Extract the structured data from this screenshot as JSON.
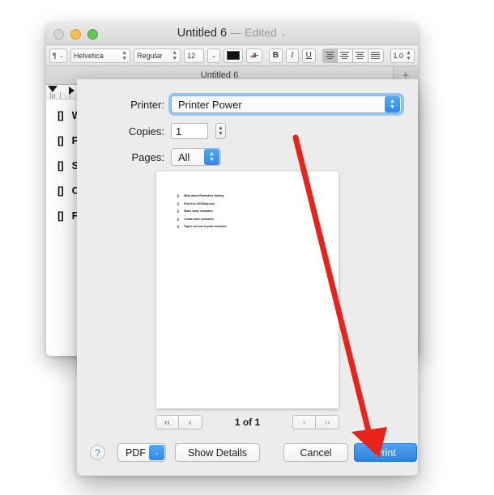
{
  "window": {
    "title": "Untitled 6",
    "separator": "—",
    "edited_label": "Edited",
    "edited_chevron": "⌄",
    "tab_label": "Untitled 6",
    "add_tab_glyph": "+",
    "ruler_zero": "0"
  },
  "format_bar": {
    "paragraph_glyph": "¶",
    "paragraph_chevron": "⌄",
    "font_family": "Helvetica",
    "font_style": "Regular",
    "font_size": "12",
    "size_chevron": "⌄",
    "text_color": "#111111",
    "strike_glyph": "a",
    "bold_glyph": "B",
    "italic_glyph": "I",
    "underline_glyph": "U",
    "line_spacing": "1.0",
    "stepper_up": "▲",
    "stepper_down": "▼"
  },
  "document": {
    "lines": [
      {
        "checkbox": "[]",
        "text": "Write about Reminders sharing"
      },
      {
        "checkbox": "[]",
        "text": "Print it to OSXDaily.com"
      },
      {
        "checkbox": "[]",
        "text": "Share some reminders"
      },
      {
        "checkbox": "[]",
        "text": "Create some reminders"
      },
      {
        "checkbox": "[]",
        "text": "Figure out how to print reminders"
      }
    ]
  },
  "print_sheet": {
    "printer_label": "Printer:",
    "printer_value": "Printer Power",
    "copies_label": "Copies:",
    "copies_value": "1",
    "pages_label": "Pages:",
    "pages_value": "All",
    "popup_up_arrow": "▲",
    "popup_down_arrow": "▼",
    "pager": {
      "first_glyph": "‹‹",
      "prev_glyph": "‹",
      "count_label": "1 of 1",
      "next_glyph": "›",
      "last_glyph": "››"
    },
    "buttons": {
      "help": "?",
      "pdf": "PDF",
      "pdf_arrow": "⌄",
      "show_details": "Show Details",
      "cancel": "Cancel",
      "print": "Print"
    },
    "preview_lines": [
      {
        "checkbox": "[]",
        "text": "Write about Reminders sharing"
      },
      {
        "checkbox": "[]",
        "text": "Print it to OSXDaily.com"
      },
      {
        "checkbox": "[]",
        "text": "Share some reminders"
      },
      {
        "checkbox": "[]",
        "text": "Create some reminders"
      },
      {
        "checkbox": "[]",
        "text": "Figure out how to print reminders"
      }
    ]
  },
  "annotation": {
    "arrow_color": "#e8231c"
  }
}
